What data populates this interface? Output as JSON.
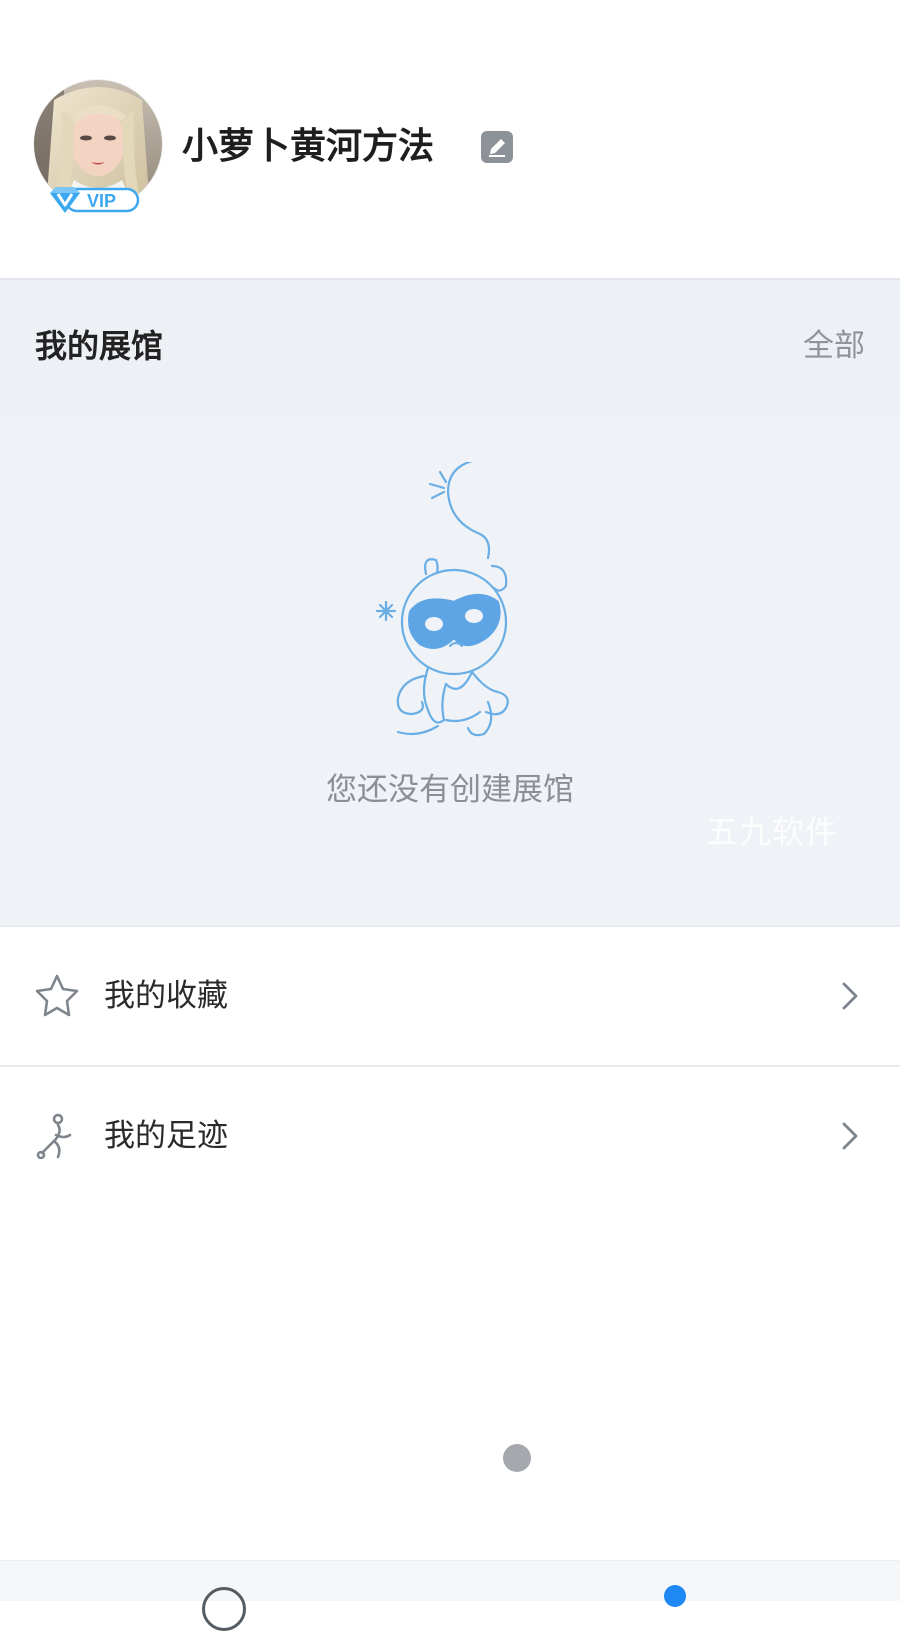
{
  "profile": {
    "username": "小萝卜黄河方法",
    "vip_label": "VIP",
    "avatar_icon": "avatar-photo",
    "edit_icon": "edit-icon"
  },
  "gallery": {
    "title": "我的展馆",
    "all_label": "全部",
    "empty_text": "您还没有创建展馆",
    "empty_icon": "monkey-mascot-icon",
    "watermark": "五九软件"
  },
  "menu": {
    "items": [
      {
        "label": "我的收藏",
        "icon": "star-icon"
      },
      {
        "label": "我的足迹",
        "icon": "footprint-icon"
      }
    ]
  },
  "tabbar": {
    "items": [
      {
        "icon": "home-icon"
      },
      {
        "icon": "profile-icon",
        "active": true
      }
    ]
  },
  "colors": {
    "accent": "#1e88f5",
    "mascot_blue": "#6aaee6",
    "mascot_fill": "#5ea5e6",
    "gallery_bg": "#eff2f6",
    "vip_blue": "#3ca8f0",
    "muted_text": "#8f949b"
  }
}
